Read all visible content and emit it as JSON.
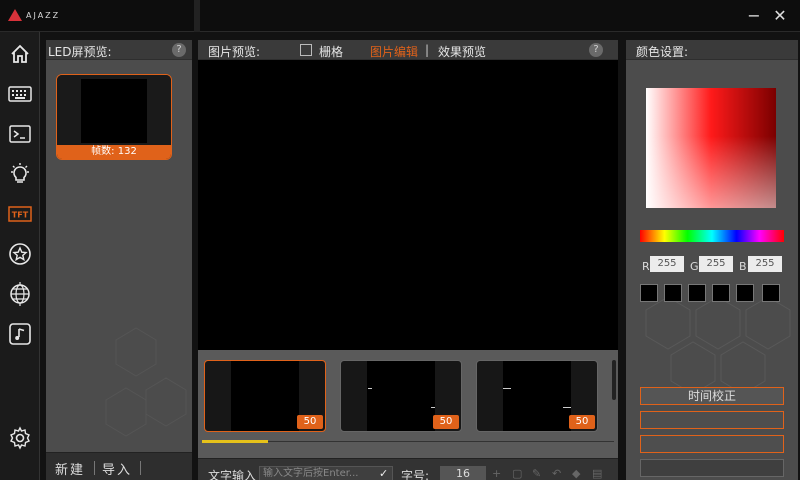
{
  "app": {
    "logo_text": "AJAZZ"
  },
  "window": {
    "minimize_glyph": "−",
    "close_glyph": "✕"
  },
  "nav": {
    "items": [
      {
        "name": "home-icon"
      },
      {
        "name": "keyboard-icon"
      },
      {
        "name": "terminal-icon"
      },
      {
        "name": "lightbulb-icon"
      },
      {
        "name": "tft-icon",
        "label": "TFT"
      },
      {
        "name": "star-icon"
      },
      {
        "name": "globe-icon"
      },
      {
        "name": "music-icon"
      }
    ],
    "settings": {
      "name": "gear-icon"
    }
  },
  "led_panel": {
    "title": "LED屏预览:",
    "help": "?",
    "frame_count_label": "帧数: 132",
    "new_label": "新建",
    "import_label": "导入"
  },
  "preview_panel": {
    "title": "图片预览:",
    "grid_label": "栅格",
    "tab_edit": "图片编辑",
    "separator": "|",
    "tab_effect": "效果预览",
    "help": "?",
    "frames": [
      {
        "count": "50",
        "selected": true
      },
      {
        "count": "50",
        "selected": false
      },
      {
        "count": "50",
        "selected": false
      }
    ],
    "text_input_label": "文字输入",
    "text_input_placeholder": "输入文字后按Enter...",
    "font_size_label": "字号:",
    "font_size_value": "16"
  },
  "color_panel": {
    "title": "颜色设置:",
    "r_label": "R",
    "r_value": "255",
    "g_label": "G",
    "g_value": "255",
    "b_label": "B",
    "b_value": "255",
    "time_calibration": "时间校正"
  },
  "colors": {
    "accent": "#e0621a",
    "progress": "#e6c21a",
    "panel": "#4c4c4c"
  }
}
